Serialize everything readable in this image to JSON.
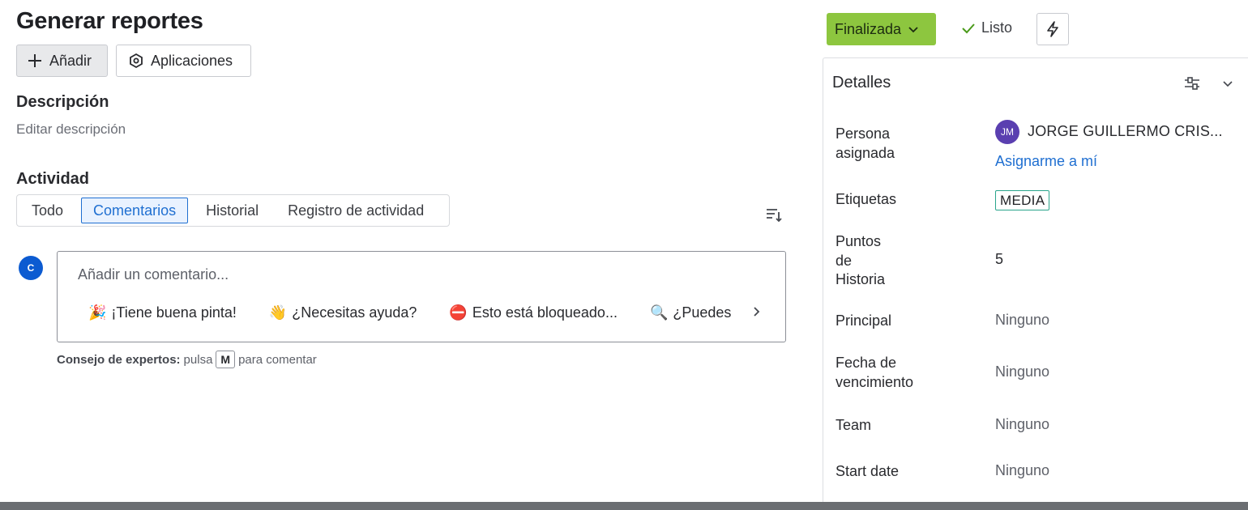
{
  "page": {
    "title": "Generar reportes",
    "add_label": "Añadir",
    "apps_label": "Aplicaciones",
    "description_heading": "Descripción",
    "description_placeholder": "Editar descripción",
    "activity_heading": "Actividad"
  },
  "activity_tabs": [
    {
      "label": "Todo",
      "active": false
    },
    {
      "label": "Comentarios",
      "active": true
    },
    {
      "label": "Historial",
      "active": false
    },
    {
      "label": "Registro de actividad",
      "active": false
    }
  ],
  "comment": {
    "avatar_initial": "C",
    "placeholder": "Añadir un comentario...",
    "quick_replies": [
      {
        "emoji": "🎉",
        "label": "¡Tiene buena pinta!"
      },
      {
        "emoji": "👋",
        "label": "¿Necesitas ayuda?"
      },
      {
        "emoji": "⛔",
        "label": "Esto está bloqueado..."
      },
      {
        "emoji": "🔍",
        "label": "¿Puedes"
      }
    ],
    "tip_bold": "Consejo de expertos:",
    "tip_pre": "pulsa",
    "tip_key": "M",
    "tip_post": "para comentar"
  },
  "status": {
    "label": "Finalizada",
    "color": "#8dc63f",
    "resolution": "Listo"
  },
  "details": {
    "title": "Detalles",
    "assignee_label_1": "Persona",
    "assignee_label_2": "asignada",
    "assignee_initials": "JM",
    "assignee_name": "JORGE GUILLERMO CRIS...",
    "assign_me": "Asignarme a mí",
    "labels_label": "Etiquetas",
    "labels_value": "MEDIA",
    "points_label_1": "Puntos",
    "points_label_2": "de",
    "points_label_3": "Historia",
    "points_value": "5",
    "parent_label": "Principal",
    "parent_value": "Ninguno",
    "due_label_1": "Fecha de",
    "due_label_2": "vencimiento",
    "due_value": "Ninguno",
    "team_label": "Team",
    "team_value": "Ninguno",
    "start_label": "Start date",
    "start_value": "Ninguno"
  }
}
